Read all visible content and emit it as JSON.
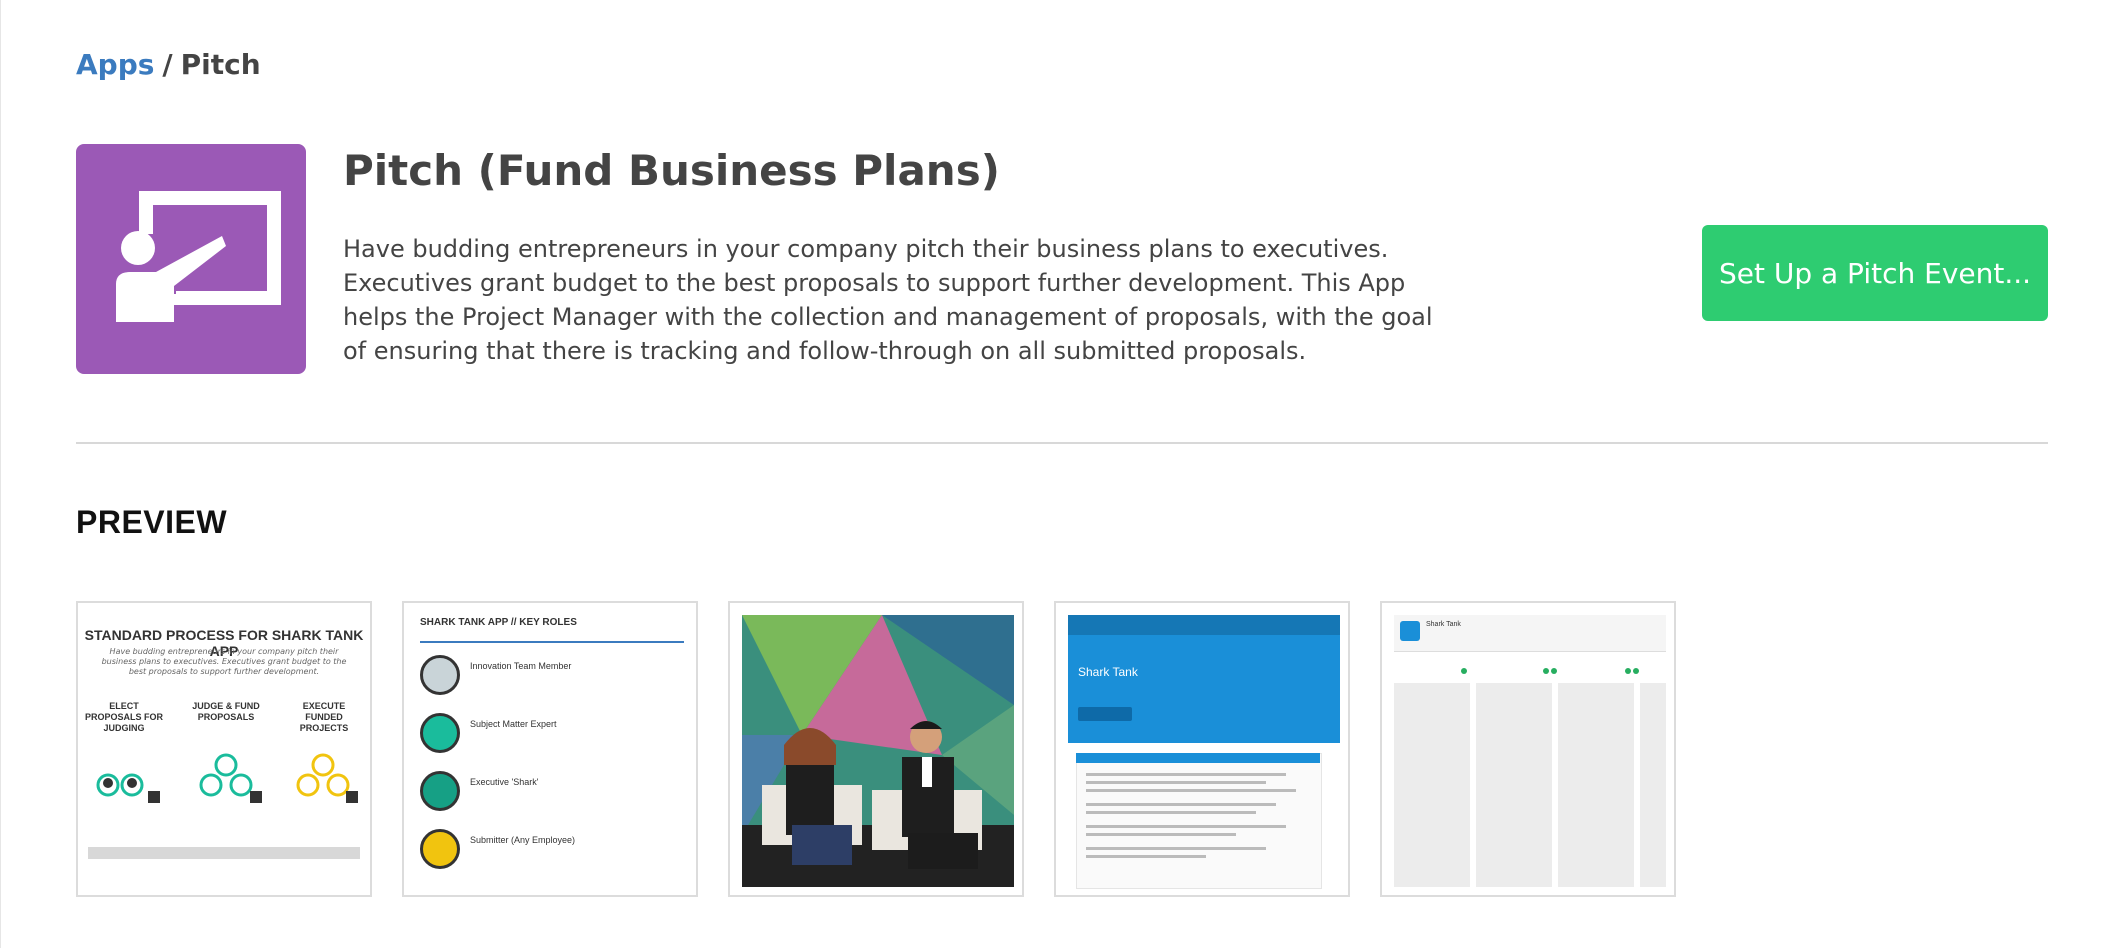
{
  "breadcrumb": {
    "apps_link": "Apps",
    "separator": "/",
    "current": "Pitch"
  },
  "app": {
    "icon": "presenter-at-board-icon",
    "icon_bg_color": "#9b59b6",
    "title": "Pitch (Fund Business Plans)",
    "description": "Have budding entrepreneurs in your company pitch their business plans to executives. Executives grant budget to the best proposals to support further development. This App helps the Project Manager with the collection and management of proposals, with the goal of ensuring that there is tracking and follow-through on all submitted proposals."
  },
  "actions": {
    "setup_button": "Set Up a Pitch Event...",
    "setup_button_color": "#2ecc71"
  },
  "preview": {
    "heading": "PREVIEW",
    "thumbnails": [
      {
        "kind": "process-diagram",
        "title": "STANDARD PROCESS FOR SHARK TANK APP",
        "subtitle": "Have budding entrepreneurs in your company pitch their business plans to executives. Executives grant budget to the best proposals to support further development.",
        "columns": [
          "ELECT PROPOSALS FOR JUDGING",
          "JUDGE & FUND PROPOSALS",
          "EXECUTE FUNDED PROJECTS"
        ]
      },
      {
        "kind": "key-roles",
        "title": "SHARK TANK APP // KEY ROLES",
        "roles": [
          "Innovation Team Member",
          "Subject Matter Expert",
          "Executive 'Shark'",
          "Submitter (Any Employee)"
        ]
      },
      {
        "kind": "event-photo"
      },
      {
        "kind": "app-screenshot",
        "title": "Shark Tank"
      },
      {
        "kind": "board-screenshot",
        "title": "Shark Tank"
      }
    ]
  }
}
